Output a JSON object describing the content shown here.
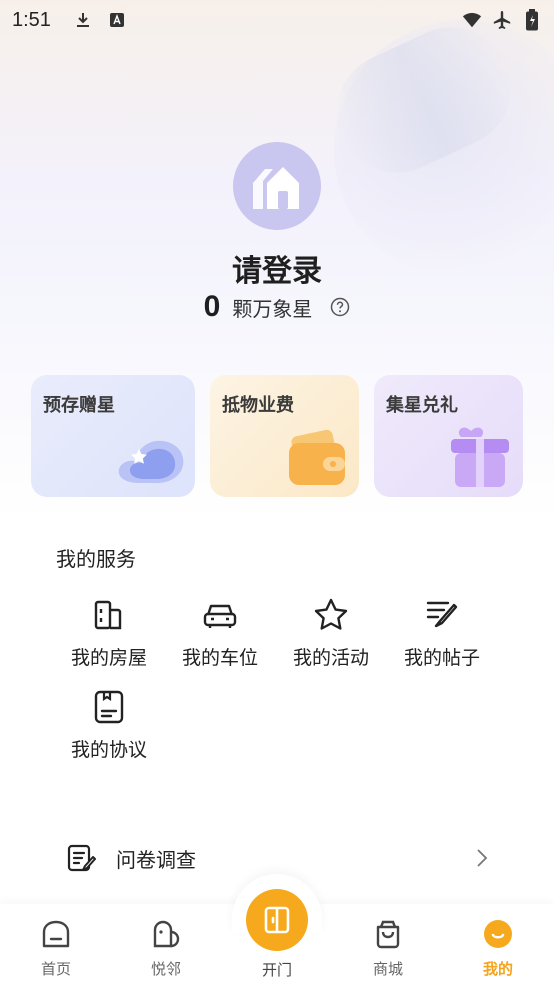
{
  "status_bar": {
    "time": "1:51"
  },
  "profile": {
    "title": "请登录",
    "stars_count": "0",
    "stars_label": "颗万象星"
  },
  "promo_cards": [
    {
      "label": "预存赠星"
    },
    {
      "label": "抵物业费"
    },
    {
      "label": "集星兑礼"
    }
  ],
  "services": {
    "title": "我的服务",
    "items": [
      {
        "label": "我的房屋",
        "icon": "building-icon"
      },
      {
        "label": "我的车位",
        "icon": "car-icon"
      },
      {
        "label": "我的活动",
        "icon": "star-icon"
      },
      {
        "label": "我的帖子",
        "icon": "post-pen-icon"
      },
      {
        "label": "我的协议",
        "icon": "agreement-icon"
      }
    ]
  },
  "survey": {
    "label": "问卷调查"
  },
  "bottom_nav": {
    "items": [
      {
        "label": "首页",
        "icon": "home-icon"
      },
      {
        "label": "悦邻",
        "icon": "neighbor-icon"
      },
      {
        "label": "开门",
        "icon": "door-icon"
      },
      {
        "label": "商城",
        "icon": "shopping-bag-icon"
      },
      {
        "label": "我的",
        "icon": "profile-smile-icon",
        "active": true
      }
    ]
  },
  "colors": {
    "accent": "#f6a91d",
    "avatar_bg": "#c9c6ef"
  }
}
